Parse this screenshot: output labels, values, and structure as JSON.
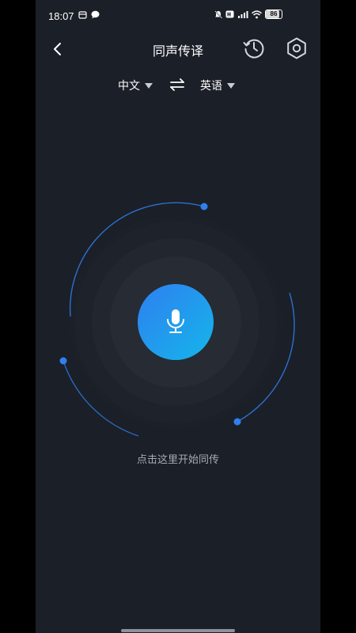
{
  "status_bar": {
    "time": "18:07",
    "battery": "86",
    "battery_level": 0.86
  },
  "header": {
    "title": "同声传译"
  },
  "languages": {
    "source": "中文",
    "target": "英语"
  },
  "hint": "点击这里开始同传",
  "colors": {
    "background": "#1b1f27",
    "accent_start": "#2f7ff0",
    "accent_end": "#14b6ea",
    "orbit": "#2f7ff0"
  },
  "icons": {
    "back": "back-chevron-icon",
    "history": "history-clock-icon",
    "settings": "gear-icon",
    "swap": "swap-arrows-icon",
    "microphone": "microphone-icon"
  }
}
